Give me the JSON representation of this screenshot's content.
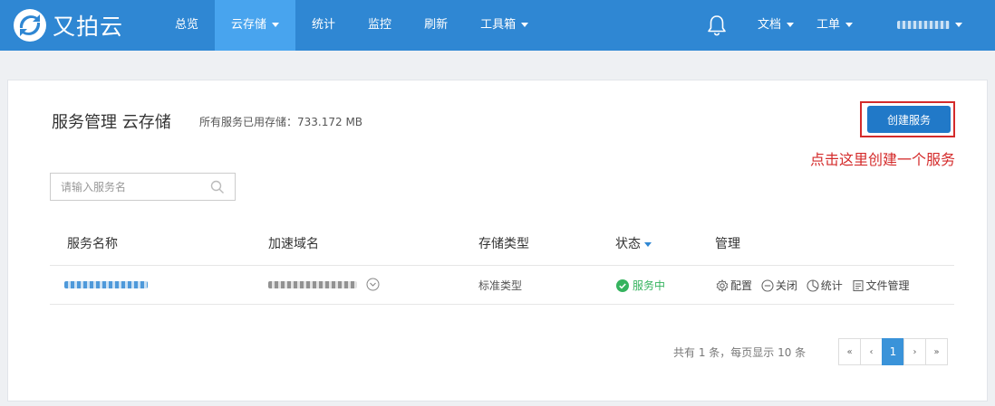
{
  "brand": {
    "name": "又拍云"
  },
  "nav": {
    "items": [
      {
        "label": "总览",
        "active": false,
        "dropdown": false
      },
      {
        "label": "云存储",
        "active": true,
        "dropdown": true
      },
      {
        "label": "统计",
        "active": false,
        "dropdown": false
      },
      {
        "label": "监控",
        "active": false,
        "dropdown": false
      },
      {
        "label": "刷新",
        "active": false,
        "dropdown": false
      },
      {
        "label": "工具箱",
        "active": false,
        "dropdown": true
      }
    ],
    "right": {
      "docs": "文档",
      "tickets": "工单"
    }
  },
  "page": {
    "title": "服务管理 云存储",
    "usage_label": "所有服务已用存储：",
    "usage_value": "733.172 MB",
    "create_button": "创建服务",
    "hint": "点击这里创建一个服务"
  },
  "search": {
    "placeholder": "请输入服务名"
  },
  "table": {
    "headers": [
      "服务名称",
      "加速域名",
      "存储类型",
      "状态",
      "管理"
    ],
    "rows": [
      {
        "storage_type": "标准类型",
        "status": "服务中",
        "actions": [
          "配置",
          "关闭",
          "统计",
          "文件管理"
        ]
      }
    ]
  },
  "pagination": {
    "info": "共有 1 条，每页显示 10 条",
    "first": "«",
    "prev": "‹",
    "current": "1",
    "next": "›",
    "last": "»"
  },
  "colors": {
    "nav_bg": "#2f87d3",
    "nav_active": "#48a4ee",
    "primary": "#2179c8",
    "hint_red": "#d42b2b",
    "status_green": "#35b35e"
  }
}
